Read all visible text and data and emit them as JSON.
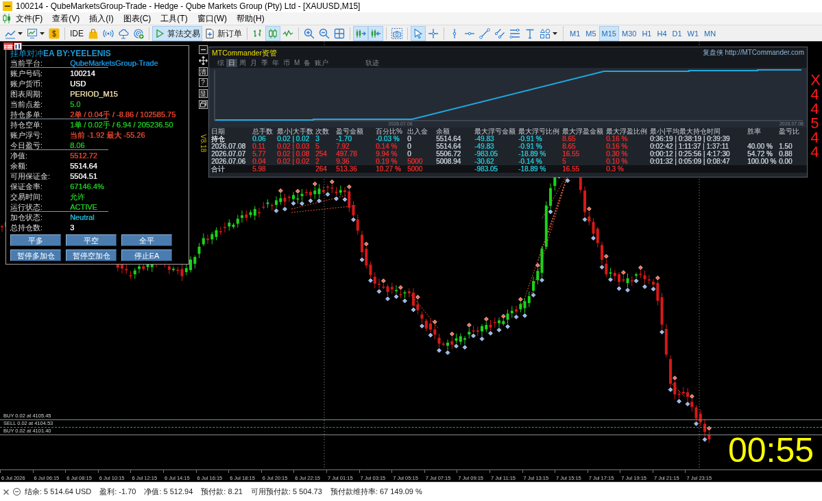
{
  "window": {
    "title": "100214 - QubeMarketsGroup-Trade - Hedge - Qube Markets Group (Pty) Ltd - [XAUUSD,M15]"
  },
  "menu": [
    "文件(F)",
    "查看(V)",
    "插入(I)",
    "图表(C)",
    "工具(T)",
    "窗口(W)",
    "帮助(H)"
  ],
  "toolbar": {
    "groups": [
      [
        {
          "kind": "icon",
          "pressed": false,
          "dropdown": true
        },
        {
          "kind": "icon",
          "pressed": false,
          "dropdown": true
        },
        {
          "kind": "icon",
          "pressed": false,
          "dropdown": false
        }
      ],
      [
        {
          "kind": "text",
          "label": "IDE",
          "pressed": false,
          "dropdown": false
        },
        {
          "kind": "icon",
          "pressed": false,
          "dropdown": false
        },
        {
          "kind": "icon",
          "pressed": false,
          "dropdown": false
        },
        {
          "kind": "icon",
          "pressed": false,
          "dropdown": false
        },
        {
          "kind": "icon",
          "pressed": false,
          "dropdown": false
        }
      ],
      [
        {
          "kind": "icon_text",
          "label": "算法交易",
          "pressed": true,
          "dropdown": false
        },
        {
          "kind": "icon_text",
          "label": "新订单",
          "pressed": false,
          "dropdown": false
        }
      ],
      [
        {
          "kind": "icon",
          "pressed": false,
          "dropdown": false
        },
        {
          "kind": "icon",
          "pressed": true,
          "dropdown": false
        },
        {
          "kind": "icon",
          "pressed": false,
          "dropdown": false
        }
      ],
      [
        {
          "kind": "icon",
          "pressed": false,
          "dropdown": false
        },
        {
          "kind": "icon",
          "pressed": false,
          "dropdown": false
        },
        {
          "kind": "icon",
          "pressed": false,
          "dropdown": false
        }
      ],
      [
        {
          "kind": "icon",
          "pressed": true,
          "dropdown": false
        },
        {
          "kind": "icon",
          "pressed": true,
          "dropdown": false
        }
      ],
      [
        {
          "kind": "icon",
          "pressed": false,
          "dropdown": false
        }
      ],
      [
        {
          "kind": "icon",
          "pressed": true,
          "dropdown": false
        },
        {
          "kind": "icon",
          "pressed": false,
          "dropdown": false
        }
      ],
      [
        {
          "kind": "icon",
          "pressed": false,
          "dropdown": false
        },
        {
          "kind": "icon",
          "pressed": false,
          "dropdown": false
        },
        {
          "kind": "icon",
          "pressed": false,
          "dropdown": false
        },
        {
          "kind": "icon",
          "pressed": false,
          "dropdown": false
        },
        {
          "kind": "icon",
          "pressed": false,
          "dropdown": false
        },
        {
          "kind": "icon",
          "pressed": false,
          "dropdown": false
        },
        {
          "kind": "icon",
          "pressed": false,
          "dropdown": true
        }
      ]
    ],
    "timeframes": [
      {
        "label": "M1",
        "selected": false
      },
      {
        "label": "M5",
        "selected": false
      },
      {
        "label": "M15",
        "selected": true
      },
      {
        "label": "M30",
        "selected": false
      },
      {
        "label": "H1",
        "selected": false
      },
      {
        "label": "H4",
        "selected": false
      },
      {
        "label": "D1",
        "selected": false
      },
      {
        "label": "W1",
        "selected": false
      },
      {
        "label": "MN",
        "selected": false
      }
    ]
  },
  "ea_panel": {
    "title": "挂单对冲**EA BY:YEELENIS**",
    "sections": [
      {
        "rows": [
          {
            "label": "当前平台:",
            "value": "QubeMarketsGroup-Trade",
            "color": "#1a8fd8"
          }
        ]
      },
      {
        "rows": [
          {
            "label": "账户号码:",
            "value": "100214",
            "color": "#f2f2f2"
          },
          {
            "label": "账户货币:",
            "value": "USD",
            "color": "#f2f2f2"
          },
          {
            "label": "图表周期:",
            "value": "PERIOD_M15",
            "color": "#e6d6a6"
          },
          {
            "label": "当前点差:",
            "value": "5.0",
            "color": "#1fc21f"
          },
          {
            "label": "持仓多单:",
            "value": "2单 / 0.04手 / -8.86 / 102585.75",
            "color": "#e2452f"
          }
        ]
      },
      {
        "rows": [
          {
            "label": "持仓空单:",
            "value": "1单 / 0.02手 / 6.94 / 205236.50",
            "color": "#1fc21f"
          },
          {
            "label": "账户浮亏:",
            "value": "当前 -1.92  最大 -55.26",
            "color": "#e2452f"
          },
          {
            "label": "今日盈亏:",
            "value": "8.06",
            "color": "#1fc21f"
          }
        ]
      },
      {
        "rows": [
          {
            "label": "净值:",
            "value": "5512.72",
            "color": "#e2452f"
          },
          {
            "label": "余额:",
            "value": "5514.64",
            "color": "#f2f2f2"
          },
          {
            "label": "可用保证金:",
            "value": "5504.51",
            "color": "#f2f2f2"
          },
          {
            "label": "保证金率:",
            "value": "67146.4%",
            "color": "#1fc21f"
          },
          {
            "label": "交易时间:",
            "value": "允许",
            "color": "#1fc21f"
          },
          {
            "label": "运行状态:",
            "value": "ACTIVE",
            "color": "#1fc21f"
          }
        ]
      },
      {
        "rows": [
          {
            "label": "加仓状态:",
            "value": "Neutral",
            "color": "#1fb4d2"
          },
          {
            "label": "总持仓数:",
            "value": "3",
            "color": "#f2f2f2"
          }
        ]
      }
    ],
    "buttons": [
      [
        "平多",
        "平空",
        "全平"
      ],
      [
        "暂停多加仓",
        "暂停空加仓",
        "停止EA"
      ]
    ]
  },
  "commander": {
    "side_tools": [
      {
        "kind": "icon"
      },
      {
        "kind": "icon"
      },
      {
        "kind": "label",
        "label": "清"
      },
      {
        "kind": "label",
        "label": "?"
      },
      {
        "kind": "label",
        "label": "显"
      },
      {
        "kind": "icon"
      }
    ],
    "version": "V8.18",
    "title": "MTCommander资管",
    "site": "复盘侠 http://MTCommander.com",
    "tabs": [
      {
        "label": "综",
        "selected": false
      },
      {
        "label": "日",
        "selected": true
      },
      {
        "label": "周",
        "selected": false
      },
      {
        "label": "月",
        "selected": false
      },
      {
        "label": "季",
        "selected": false
      },
      {
        "label": "年",
        "selected": false
      },
      {
        "label": "币",
        "selected": false
      },
      {
        "label": "M",
        "selected": false
      },
      {
        "label": "备",
        "selected": false
      },
      {
        "label": "账户",
        "selected": false
      }
    ],
    "trace_tab": "轨迹",
    "equity_dates": [
      "2026.07.06",
      "2026.07.08"
    ],
    "table": {
      "columns": [
        "日期",
        "总手数",
        "最小|大手数",
        "次数",
        "盈亏金额",
        "百分比%",
        "出入金",
        "余额",
        "最大浮亏金额",
        "最大浮亏比例",
        "最大浮盈金额",
        "最大浮盈比例",
        "最小|平均最大持仓时间",
        "胜率",
        "盈亏比"
      ],
      "rows": [
        {
          "kind": "open",
          "date": {
            "text": "持仓",
            "color": "#eef0f2"
          },
          "lots": {
            "text": "0.06",
            "color": "#22c3d3"
          },
          "min_max_lots": {
            "text": "0.02 | 0.02",
            "color": "#22c3d3"
          },
          "count": {
            "text": "3",
            "color": "#22c3d3"
          },
          "pnl": {
            "text": "-1.70",
            "color": "#22c3d3"
          },
          "percent": {
            "text": "-0.03 %",
            "color": "#22c3d3"
          },
          "deposit": {
            "text": "0",
            "color": "#c3cad2"
          },
          "balance": {
            "text": "5514.64",
            "color": "#c3cad2"
          },
          "max_float_loss": {
            "text": "-49.83",
            "color": "#22c3d3"
          },
          "max_float_loss_pct": {
            "text": "-0.91 %",
            "color": "#22c3d3"
          },
          "max_float_profit": {
            "text": "8.65",
            "color": "#e02a2a"
          },
          "max_float_profit_pct": {
            "text": "0.16 %",
            "color": "#e02a2a"
          },
          "hold_time": {
            "text": "0:36:19 | 0:38:19 | 0:39:39",
            "color": "#c3cad2"
          }
        },
        {
          "kind": "day",
          "date": {
            "text": "2026.07.08",
            "color": "#c3cad2"
          },
          "lots": {
            "text": "0.11",
            "color": "#e02a2a"
          },
          "min_max_lots": {
            "text": "0.02 | 0.03",
            "color": "#e02a2a"
          },
          "count": {
            "text": "5",
            "color": "#e02a2a"
          },
          "pnl": {
            "text": "7.92",
            "color": "#e02a2a"
          },
          "percent": {
            "text": "0.14 %",
            "color": "#e02a2a"
          },
          "deposit": {
            "text": "0",
            "color": "#c3cad2"
          },
          "balance": {
            "text": "5514.64",
            "color": "#c3cad2"
          },
          "max_float_loss": {
            "text": "-49.83",
            "color": "#22c3d3"
          },
          "max_float_loss_pct": {
            "text": "-0.91 %",
            "color": "#22c3d3"
          },
          "max_float_profit": {
            "text": "8.65",
            "color": "#e02a2a"
          },
          "max_float_profit_pct": {
            "text": "0.16 %",
            "color": "#e02a2a"
          },
          "hold_time": {
            "text": "0:02:42 | 1:11:37 | 1:37:11",
            "color": "#c3cad2"
          },
          "win_rate": {
            "text": "40.00 %",
            "color": "#c3cad2"
          },
          "pl_ratio": {
            "text": "1.50",
            "color": "#c3cad2"
          }
        },
        {
          "kind": "day",
          "date": {
            "text": "2026.07.07",
            "color": "#c3cad2"
          },
          "lots": {
            "text": "5.77",
            "color": "#e02a2a"
          },
          "min_max_lots": {
            "text": "0.02 | 0.08",
            "color": "#e02a2a"
          },
          "count": {
            "text": "254",
            "color": "#e02a2a"
          },
          "pnl": {
            "text": "497.78",
            "color": "#e02a2a"
          },
          "percent": {
            "text": "9.94 %",
            "color": "#e02a2a"
          },
          "deposit": {
            "text": "0",
            "color": "#c3cad2"
          },
          "balance": {
            "text": "5506.72",
            "color": "#c3cad2"
          },
          "max_float_loss": {
            "text": "-983.05",
            "color": "#22c3d3"
          },
          "max_float_loss_pct": {
            "text": "-18.89 %",
            "color": "#22c3d3"
          },
          "max_float_profit": {
            "text": "16.55",
            "color": "#e02a2a"
          },
          "max_float_profit_pct": {
            "text": "0.30 %",
            "color": "#e02a2a"
          },
          "hold_time": {
            "text": "0:00:12 | 0:25:56 | 4:17:30",
            "color": "#c3cad2"
          },
          "win_rate": {
            "text": "54.72 %",
            "color": "#c3cad2"
          },
          "pl_ratio": {
            "text": "0.88",
            "color": "#c3cad2"
          }
        },
        {
          "kind": "day",
          "date": {
            "text": "2026.07.06",
            "color": "#c3cad2"
          },
          "lots": {
            "text": "0.04",
            "color": "#e02a2a"
          },
          "min_max_lots": {
            "text": "0.02 | 0.02",
            "color": "#e02a2a"
          },
          "count": {
            "text": "2",
            "color": "#e02a2a"
          },
          "pnl": {
            "text": "9.36",
            "color": "#e02a2a"
          },
          "percent": {
            "text": "0.19 %",
            "color": "#e02a2a"
          },
          "deposit": {
            "text": "5000",
            "color": "#e02a2a"
          },
          "balance": {
            "text": "5008.94",
            "color": "#c3cad2"
          },
          "max_float_loss": {
            "text": "-30.62",
            "color": "#22c3d3"
          },
          "max_float_loss_pct": {
            "text": "-0.14 %",
            "color": "#22c3d3"
          },
          "max_float_profit": {
            "text": "5",
            "color": "#e02a2a"
          },
          "max_float_profit_pct": {
            "text": "0.10 %",
            "color": "#e02a2a"
          },
          "hold_time": {
            "text": "0:01:32 | 0:05:09 | 0:08:47",
            "color": "#c3cad2"
          },
          "win_rate": {
            "text": "100.00 %",
            "color": "#c3cad2"
          },
          "pl_ratio": {
            "text": "0.00",
            "color": "#c3cad2"
          }
        },
        {
          "kind": "total",
          "date": {
            "text": "合计",
            "color": "#c3cad2"
          },
          "lots": {
            "text": "5.98",
            "color": "#e02a2a"
          },
          "count": {
            "text": "264",
            "color": "#e02a2a"
          },
          "pnl": {
            "text": "513.36",
            "color": "#e02a2a"
          },
          "percent": {
            "text": "10.27 %",
            "color": "#e02a2a"
          },
          "deposit": {
            "text": "5000",
            "color": "#e02a2a"
          },
          "max_float_loss": {
            "text": "-983.05",
            "color": "#22c3d3"
          },
          "max_float_loss_pct": {
            "text": "-18.89 %",
            "color": "#22c3d3"
          },
          "max_float_profit": {
            "text": "16.55",
            "color": "#e02a2a"
          },
          "max_float_profit_pct": {
            "text": "0.3 %",
            "color": "#e02a2a"
          }
        }
      ]
    }
  },
  "right_edge_labels": [
    "X",
    "4",
    "4",
    "5",
    "4",
    "4"
  ],
  "order_lines": [
    {
      "kind": "buy",
      "label": "BUY 0.02 at 4105.45"
    },
    {
      "kind": "sell",
      "label": "SELL 0.02 at 4104.53"
    },
    {
      "kind": "buy",
      "label": "BUY 0.02 at 4101.40"
    }
  ],
  "countdown": "00:55",
  "time_axis": [
    "6 Jul 2026",
    "6 Jul 06:15",
    "6 Jul 08:15",
    "6 Jul 10:15",
    "6 Jul 12:15",
    "6 Jul 14:15",
    "6 Jul 16:15",
    "6 Jul 18:15",
    "6 Jul 20:15",
    "6 Jul 22:15",
    "7 Jul 01:15",
    "7 Jul 03:15",
    "7 Jul 05:15",
    "7 Jul 07:15",
    "7 Jul 09:15",
    "7 Jul 11:15",
    "7 Jul 13:15",
    "7 Jul 15:15",
    "7 Jul 17:15",
    "7 Jul 19:15",
    "7 Jul 21:15",
    "7 Jul 23:15"
  ],
  "status_bar": {
    "items": [
      "结余: 5 514.64 USD",
      "盈利: -1.70",
      "净值: 5 512.94",
      "预付款: 8.21",
      "可用预付款: 5 504.73",
      "预付款维持率: 67 149.09 %"
    ]
  }
}
